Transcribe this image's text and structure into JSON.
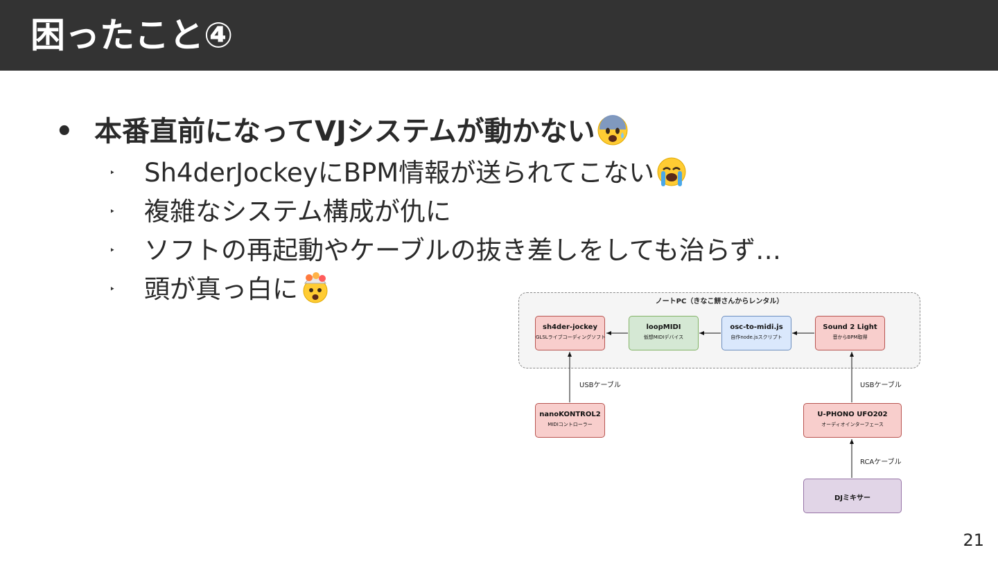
{
  "slide": {
    "title": "困ったこと④",
    "page_number": "21"
  },
  "bullets": {
    "main": {
      "marker": "•",
      "text": "本番直前になってVJシステムが動かない",
      "emoji": "anxious-face-with-sweat-icon"
    },
    "subs": [
      {
        "marker": "‣",
        "text": "Sh4derJockeyにBPM情報が送られてこない",
        "emoji": "loudly-crying-face-icon"
      },
      {
        "marker": "‣",
        "text": "複雑なシステム構成が仇に",
        "emoji": ""
      },
      {
        "marker": "‣",
        "text": "ソフトの再起動やケーブルの抜き差しをしても治らず…",
        "emoji": ""
      },
      {
        "marker": "‣",
        "text": "頭が真っ白に",
        "emoji": "exploding-head-icon"
      }
    ]
  },
  "diagram": {
    "group_label": "ノートPC（きなこ餅さんからレンタル）",
    "nodes": {
      "sh4der": {
        "title": "sh4der-jockey",
        "subtitle": "GLSLライブコーディングソフト"
      },
      "loopmidi": {
        "title": "loopMIDI",
        "subtitle": "仮想MIDIデバイス"
      },
      "osc": {
        "title": "osc-to-midi.js",
        "subtitle": "自作node.jsスクリプト"
      },
      "sound2light": {
        "title": "Sound 2 Light",
        "subtitle": "音からBPM取得"
      },
      "nanokontrol": {
        "title": "nanoKONTROL2",
        "subtitle": "MIDIコントローラー"
      },
      "uphono": {
        "title": "U-PHONO UFO202",
        "subtitle": "オーディオインターフェース"
      },
      "djmixer": {
        "title": "DJミキサー"
      }
    },
    "edge_labels": {
      "usb_left": "USBケーブル",
      "usb_right": "USBケーブル",
      "rca": "RCAケーブル"
    },
    "colors": {
      "red_fill": "#f8cecc",
      "red_stroke": "#b85450",
      "green_fill": "#d5e8d4",
      "green_stroke": "#82b366",
      "blue_fill": "#dae8fc",
      "blue_stroke": "#6c8ebf",
      "purple_fill": "#e1d5e7",
      "purple_stroke": "#9673a6"
    }
  }
}
